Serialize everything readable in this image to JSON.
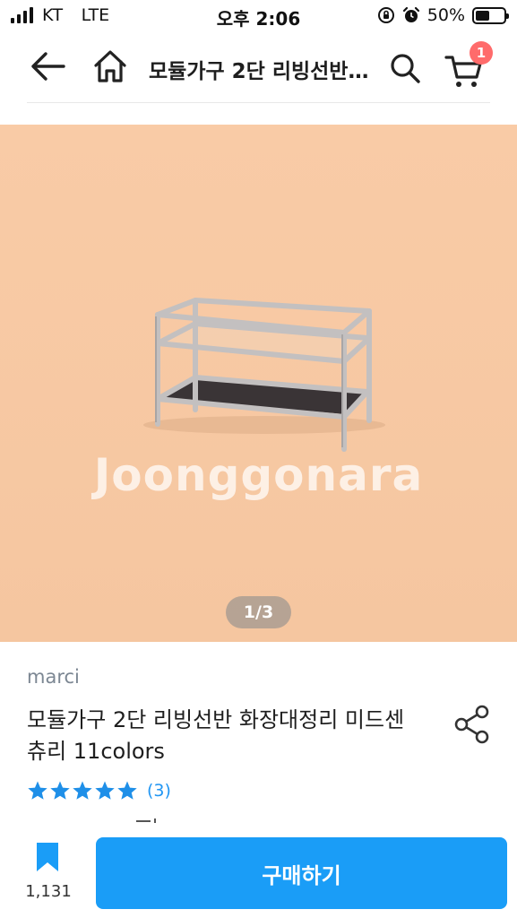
{
  "status_bar": {
    "carrier": "KT",
    "network": "LTE",
    "time": "오후 2:06",
    "battery_percent": "50%",
    "battery_level": 0.5
  },
  "header": {
    "title": "모듈가구 2단 리빙선반 화장대정리 미드센츄리 11colors",
    "cart_count": "1",
    "icons": [
      "back-arrow-icon",
      "home-icon",
      "search-icon",
      "cart-icon"
    ]
  },
  "image": {
    "watermark": "Joonggonara",
    "pager": "1/3",
    "background_color": "#f7c9a4"
  },
  "product": {
    "seller": "marci",
    "title": "모듈가구 2단 리빙선반 화장대정리 미드센츄리 11colors",
    "rating": 5,
    "review_count": "(3)"
  },
  "bottom_bar": {
    "bookmark_count": "1,131",
    "buy_label": "구매하기"
  },
  "colors": {
    "accent": "#1a9df7",
    "star": "#1e8fe8",
    "badge": "#ff6b6b",
    "seller_text": "#7c8793"
  }
}
